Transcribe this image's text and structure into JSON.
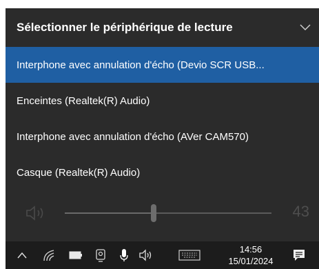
{
  "flyout": {
    "title": "Sélectionner le périphérique de lecture",
    "collapse_icon": "chevron-down-icon",
    "devices": [
      {
        "label": "Interphone avec annulation d'écho (Devio SCR USB...",
        "selected": true
      },
      {
        "label": "Enceintes (Realtek(R) Audio)",
        "selected": false
      },
      {
        "label": "Interphone avec annulation d'écho (AVer CAM570)",
        "selected": false
      },
      {
        "label": "Casque (Realtek(R) Audio)",
        "selected": false
      }
    ],
    "volume": {
      "icon": "speaker-icon",
      "value": "43",
      "level": 0.43
    }
  },
  "taskbar": {
    "icons": [
      "chevron-up-icon",
      "wifi-icon",
      "battery-icon",
      "webcam-icon",
      "microphone-icon",
      "speaker-icon",
      "keyboard-icon"
    ],
    "time": "14:56",
    "date": "15/01/2024",
    "notification_icon": "notification-icon"
  },
  "colors": {
    "flyout_bg": "#2b2b2b",
    "selected_bg": "#1f5fa3",
    "taskbar_bg": "#1c1c1c"
  }
}
